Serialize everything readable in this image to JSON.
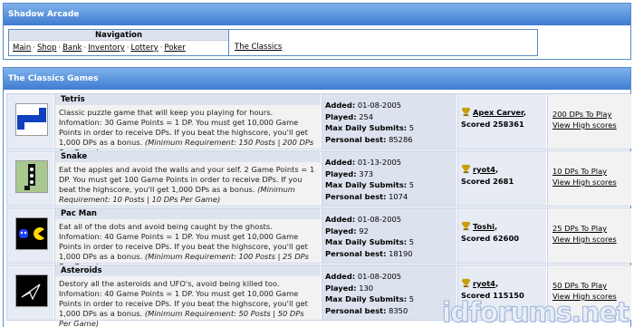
{
  "site": {
    "title": "Shadow Arcade"
  },
  "navigation": {
    "title": "Navigation",
    "links": [
      "Main",
      "Shop",
      "Bank",
      "Inventory",
      "Lottery",
      "Poker"
    ],
    "section_link": "The Classics"
  },
  "games_section": {
    "title": "The Classics Games"
  },
  "labels": {
    "added": "Added:",
    "played": "Played:",
    "max_daily": "Max Daily Submits:",
    "personal_best": "Personal best:",
    "view_high": "View High scores"
  },
  "games": [
    {
      "name": "Tetris",
      "desc": "Classic puzzle game that will keep you playing for hours. Infomation: 30 Game Points = 1 DP. You must get 10,000 Game Points in order to receive DPs. If you beat the highscore, you'll get 1,000 DPs as a bonus.",
      "req": "(Minimum Requirement: 150 Posts | 200 DPs Per Game)",
      "added": "01-08-2005",
      "played": "254",
      "max_daily": "5",
      "personal_best": "85286",
      "champ": "Apex Carver",
      "scored": "Scored 258361",
      "play": "200 DPs To Play"
    },
    {
      "name": "Snake",
      "desc": "Eat the apples and avoid the walls and your self. 2 Game Points = 1 DP. You must get 100 Game Points in order to receive DPs. If you beat the highscore, you'll get 1,000 DPs as a bonus.",
      "req": "(Minimum Requirement: 10 Posts | 10 DPs Per Game)",
      "added": "01-13-2005",
      "played": "373",
      "max_daily": "5",
      "personal_best": "1074",
      "champ": "ryot4",
      "scored": "Scored 2681",
      "play": "10 DPs To Play"
    },
    {
      "name": "Pac Man",
      "desc": "Eat all of the dots and avoid being caught by the ghosts. Infomation: 40 Game Points = 1 DP. You must get 10,000 Game Points in order to receive DPs. If you beat the highscore, you'll get 1,000 DPs as a bonus.",
      "req": "(Minimum Requirement: 100 Posts | 25 DPs Per Game)",
      "added": "01-08-2005",
      "played": "92",
      "max_daily": "5",
      "personal_best": "18190",
      "champ": "Toshi",
      "scored": "Scored 62600",
      "play": "25 DPs To Play"
    },
    {
      "name": "Asteroids",
      "desc": "Destory all the asteroids and UFO's, avoid being killed too. Infomation: 40 Game Points = 1 DP. You must get 10,000 Game Points in order to receive DPs. If you beat the highscore, you'll get 1,000 DPs as a bonus.",
      "req": "(Minimum Requirement: 50 Posts | 50 DPs Per Game)",
      "added": "01-08-2005",
      "played": "130",
      "max_daily": "5",
      "personal_best": "8350",
      "champ": "ryot4",
      "scored": "Scored 115150",
      "play": "50 DPs To Play"
    }
  ],
  "watermark": "idforums.net",
  "colors": {
    "header_gradient_top": "#7fb2ec",
    "header_gradient_bottom": "#3f7bd0",
    "border": "#5a8ac6"
  }
}
